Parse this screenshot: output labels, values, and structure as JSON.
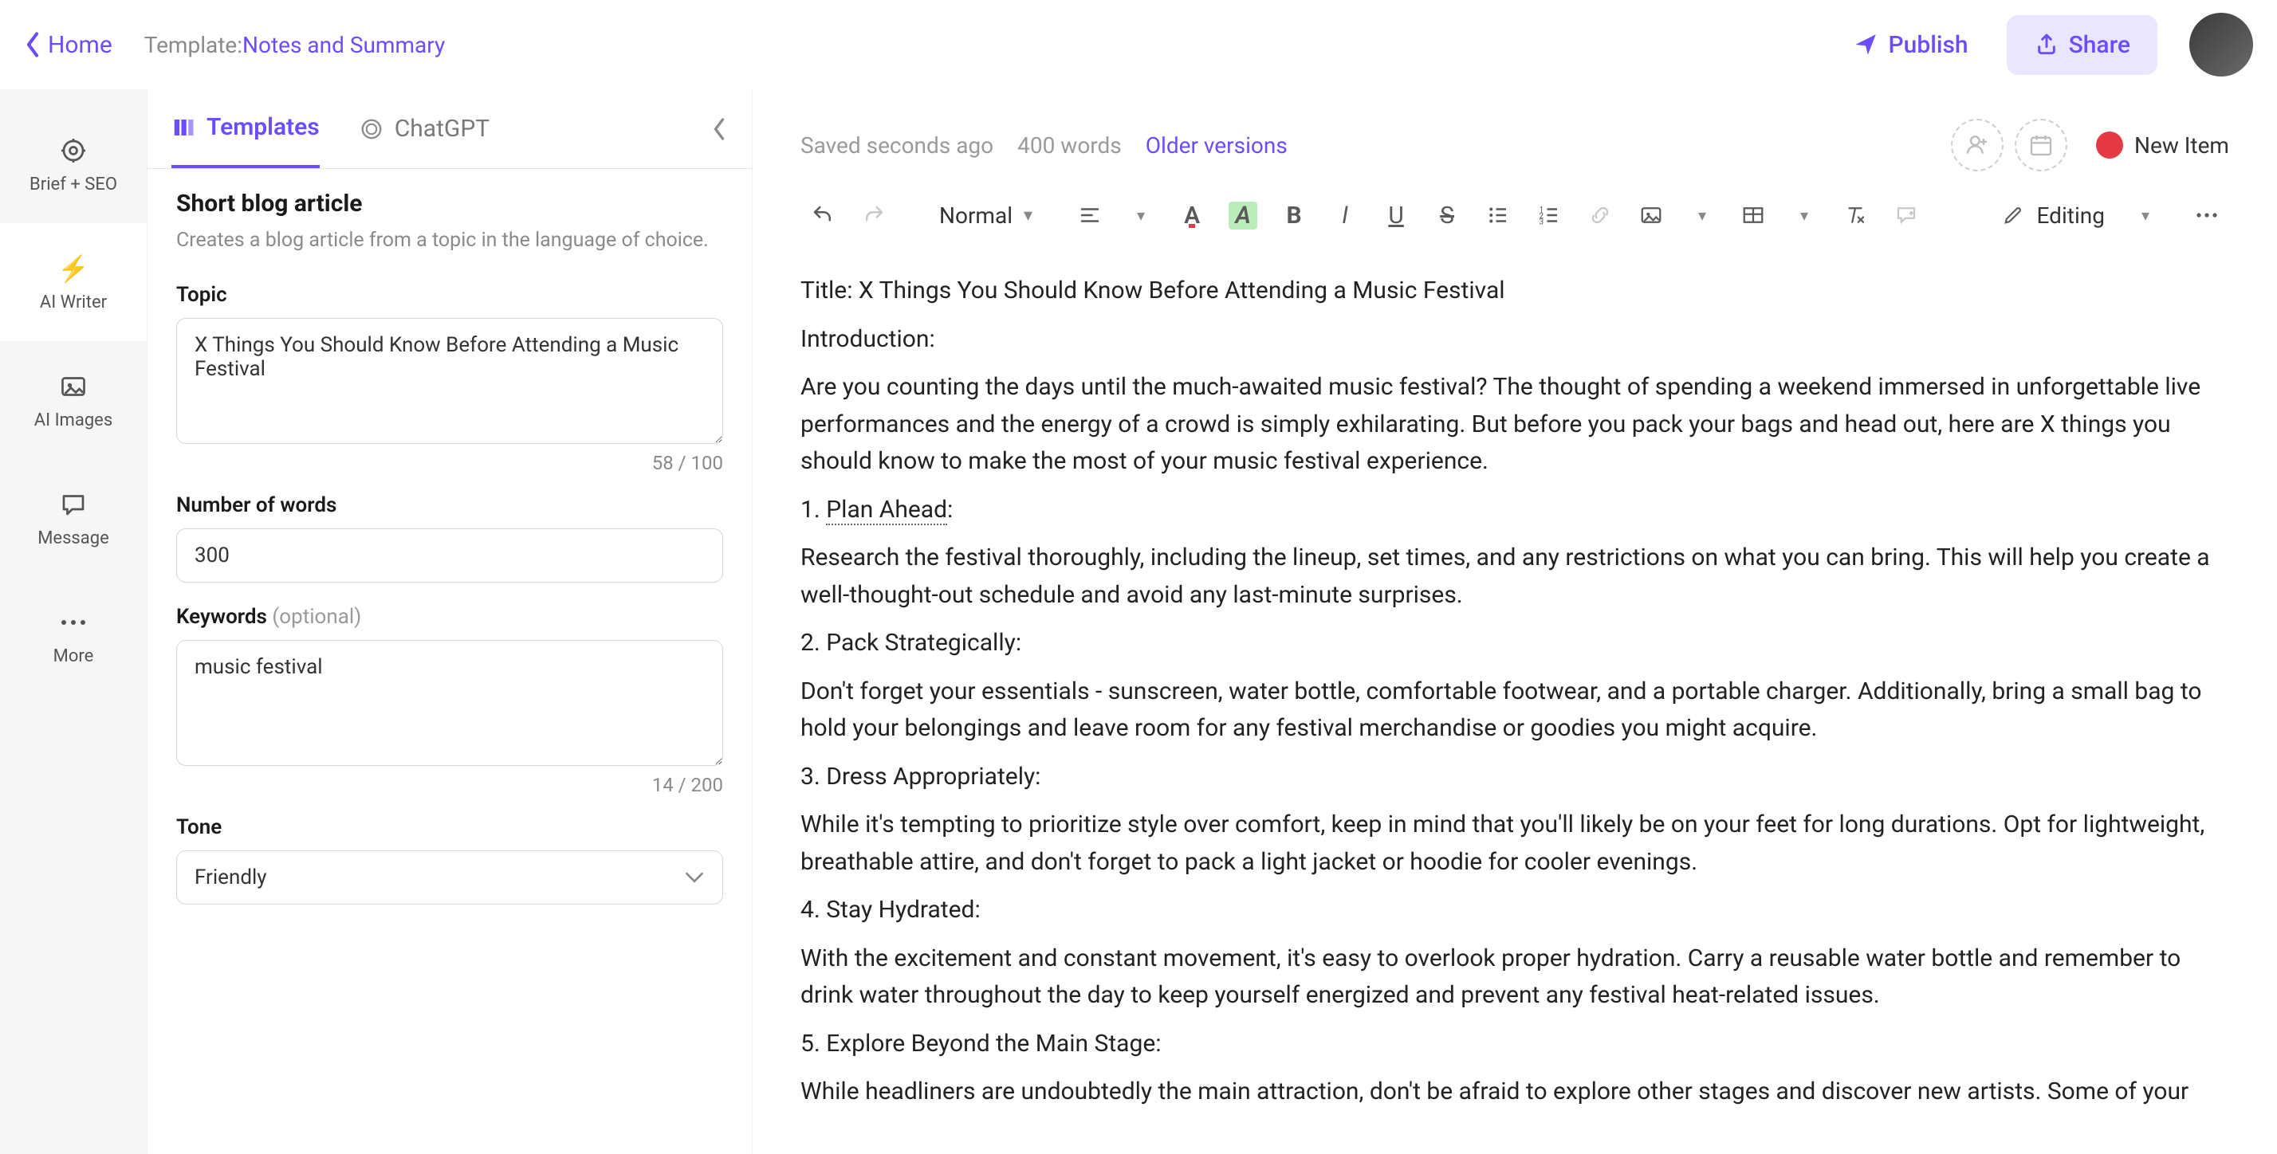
{
  "topbar": {
    "home": "Home",
    "template_label": "Template: ",
    "template_name": "Notes and Summary",
    "publish": "Publish",
    "share": "Share"
  },
  "rail": {
    "items": [
      {
        "label": "Brief + SEO",
        "icon": "target"
      },
      {
        "label": "AI Writer",
        "icon": "bolt"
      },
      {
        "label": "AI Images",
        "icon": "image"
      },
      {
        "label": "Message",
        "icon": "chat"
      },
      {
        "label": "More",
        "icon": "dots"
      }
    ],
    "active_index": 1
  },
  "panel": {
    "tabs": {
      "templates": "Templates",
      "chatgpt": "ChatGPT"
    },
    "title": "Short blog article",
    "desc": "Creates a blog article from a topic in the language of choice.",
    "topic_label": "Topic",
    "topic_value": "X Things You Should Know Before Attending a Music Festival",
    "topic_counter": "58 / 100",
    "words_label": "Number of words",
    "words_value": "300",
    "keywords_label": "Keywords",
    "keywords_optional": "(optional)",
    "keywords_value": "music festival",
    "keywords_counter": "14 / 200",
    "tone_label": "Tone",
    "tone_value": "Friendly"
  },
  "editor_top": {
    "saved": "Saved seconds ago",
    "words": "400 words",
    "older": "Older versions",
    "new_item": "New Item"
  },
  "toolbar": {
    "style": "Normal",
    "editing": "Editing"
  },
  "doc": {
    "title_line": "Title: X Things You Should Know Before Attending a Music Festival",
    "intro_h": "Introduction:",
    "intro_p": "Are you counting the days until the much-awaited music festival? The thought of spending a weekend immersed in unforgettable live performances and the energy of a crowd is simply exhilarating. But before you pack your bags and head out, here are X things you should know to make the most of your music festival experience.",
    "s1_num": "1. ",
    "s1_h": "Plan Ahead",
    "s1_colon": ":",
    "s1_p": "Research the festival thoroughly, including the lineup, set times, and any restrictions on what you can bring. This will help you create a well-thought-out schedule and avoid any last-minute surprises.",
    "s2_h": "2. Pack Strategically:",
    "s2_p": "Don't forget your essentials - sunscreen, water bottle, comfortable footwear, and a portable charger. Additionally, bring a small bag to hold your belongings and leave room for any festival merchandise or goodies you might acquire.",
    "s3_h": "3. Dress Appropriately:",
    "s3_p": "While it's tempting to prioritize style over comfort, keep in mind that you'll likely be on your feet for long durations. Opt for lightweight, breathable attire, and don't forget to pack a light jacket or hoodie for cooler evenings.",
    "s4_h": "4. Stay Hydrated:",
    "s4_p": "With the excitement and constant movement, it's easy to overlook proper hydration. Carry a reusable water bottle and remember to drink water throughout the day to keep yourself energized and prevent any festival heat-related issues.",
    "s5_h": "5. Explore Beyond the Main Stage:",
    "s5_p": "While headliners are undoubtedly the main attraction, don't be afraid to explore other stages and discover new artists. Some of your"
  }
}
